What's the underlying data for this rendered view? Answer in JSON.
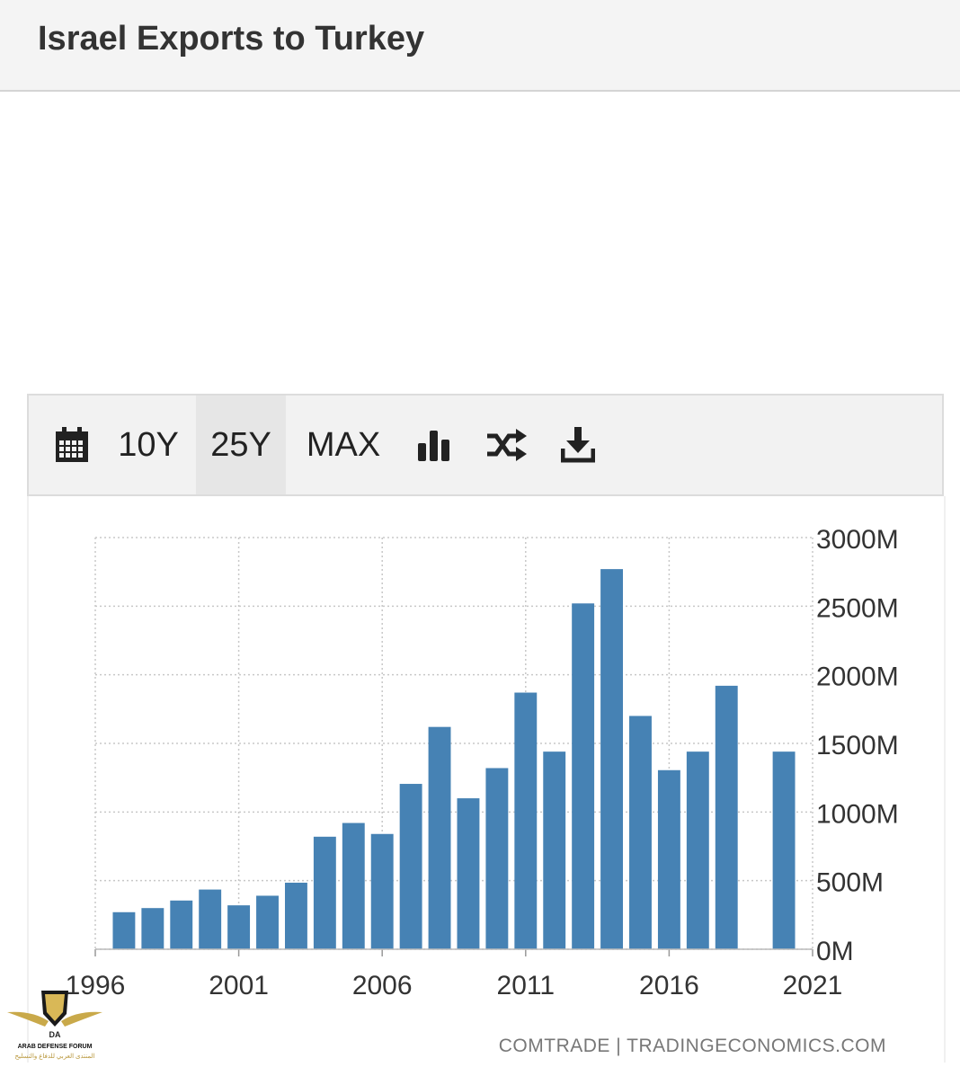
{
  "header": {
    "title": "Israel Exports to Turkey"
  },
  "toolbar": {
    "calendar_icon": "calendar-icon",
    "range_10y": "10Y",
    "range_25y": "25Y",
    "range_max": "MAX",
    "selected_range": "25Y",
    "chart_type_icon": "bar-chart-icon",
    "compare_icon": "shuffle-icon",
    "download_icon": "download-icon"
  },
  "chart_data": {
    "type": "bar",
    "title": "",
    "xlabel": "",
    "ylabel": "",
    "color": "#4682b4",
    "x": [
      1997,
      1998,
      1999,
      2000,
      2001,
      2002,
      2003,
      2004,
      2005,
      2006,
      2007,
      2008,
      2009,
      2010,
      2011,
      2012,
      2013,
      2014,
      2015,
      2016,
      2017,
      2018,
      2020
    ],
    "values": [
      270,
      300,
      355,
      435,
      320,
      390,
      485,
      820,
      920,
      840,
      1205,
      1620,
      1100,
      1320,
      1870,
      1440,
      2520,
      2770,
      1700,
      1305,
      1440,
      1920,
      1440
    ],
    "xlim": [
      1996,
      2021
    ],
    "ylim": [
      0,
      3000
    ],
    "x_ticks": [
      1996,
      2001,
      2006,
      2011,
      2016,
      2021
    ],
    "y_ticks": [
      0,
      500,
      1000,
      1500,
      2000,
      2500,
      3000
    ],
    "y_tick_labels": [
      "0M",
      "500M",
      "1000M",
      "1500M",
      "2000M",
      "2500M",
      "3000M"
    ],
    "y_axis_position": "right",
    "grid": true,
    "source": "COMTRADE | TRADINGECONOMICS.COM"
  },
  "watermark": {
    "line1": "ARAB DEFENSE FORUM",
    "line2": "المنتدى العربي للدفاع والتسليح"
  }
}
